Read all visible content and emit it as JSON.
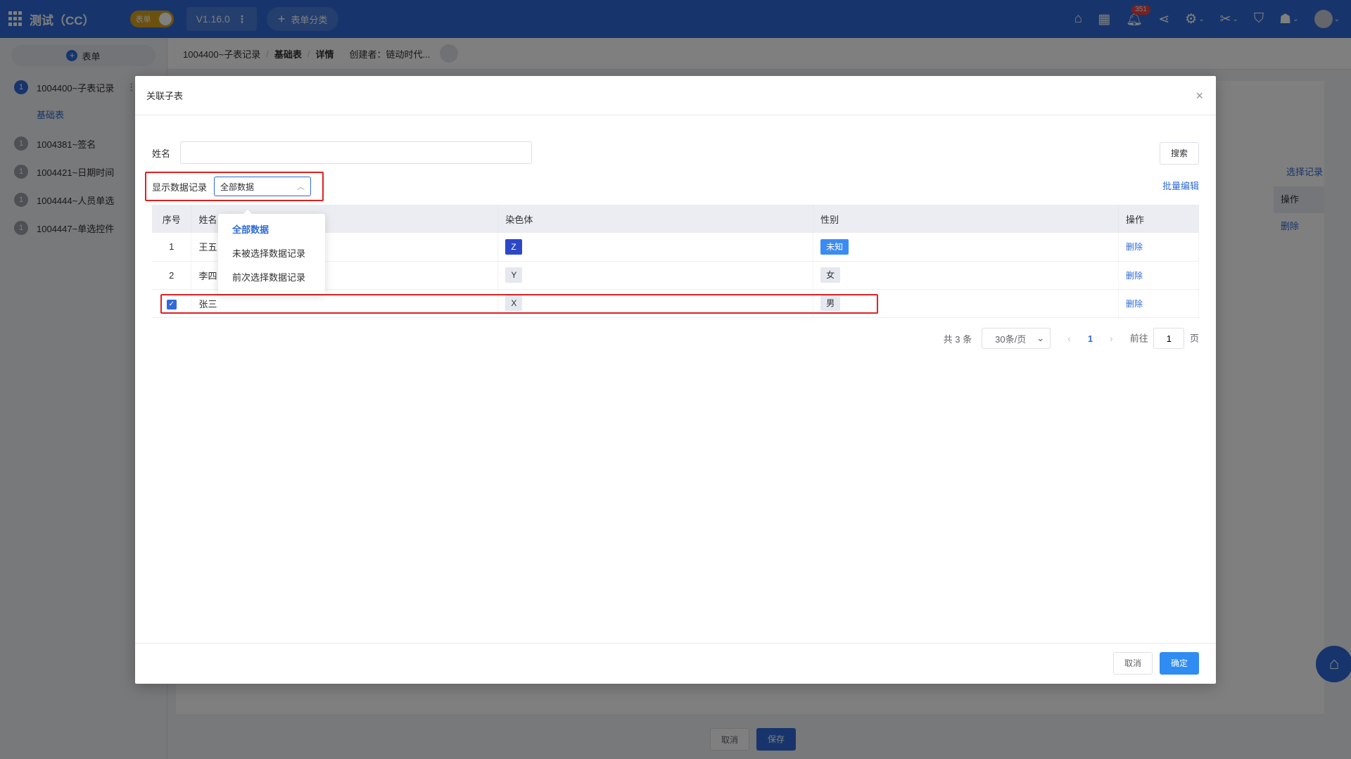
{
  "topbar": {
    "app_title": "测试（CC）",
    "toggle_label": "表单",
    "version": "V1.16.0",
    "version_more": "⋮",
    "category_plus": "+",
    "category_button": "表单分类",
    "notification_count": "351",
    "icons": [
      "home-icon",
      "grid-icon",
      "bell-icon",
      "share-icon",
      "gear-icon",
      "tools-icon",
      "shirt-icon",
      "puzzle-icon"
    ]
  },
  "sidebar": {
    "add_label": "表单",
    "add_icon": "+",
    "items": [
      {
        "num": "1",
        "label": "1004400~子表记录",
        "active": true
      },
      {
        "num": "1",
        "label": "1004381~签名"
      },
      {
        "num": "1",
        "label": "1004421~日期时间"
      },
      {
        "num": "1",
        "label": "1004444~人员单选"
      },
      {
        "num": "1",
        "label": "1004447~单选控件"
      }
    ],
    "sub_item": "基础表",
    "more": "⋮"
  },
  "page_header": {
    "crumb1": "1004400~子表记录",
    "crumb2": "基础表",
    "crumb3": "详情",
    "sep": "/",
    "creator": "创建者：链动时代..."
  },
  "background": {
    "select_records": "选择记录",
    "op_header": "操作",
    "op_delete": "删除",
    "cancel": "取消",
    "save": "保存"
  },
  "modal": {
    "title": "关联子表",
    "close": "×",
    "name_label": "姓名",
    "name_value": "",
    "search_button": "搜索",
    "show_label": "显示数据记录",
    "show_value": "全部数据",
    "batch_edit": "批量编辑",
    "dropdown": [
      "全部数据",
      "未被选择数据记录",
      "前次选择数据记录"
    ],
    "columns": [
      "序号",
      "姓名",
      "染色体",
      "性别",
      "操作"
    ],
    "rows": [
      {
        "idx": "1",
        "name": "王五",
        "chromosome": "Z",
        "gender": "未知",
        "op": "删除"
      },
      {
        "idx": "2",
        "name": "李四",
        "chromosome": "Y",
        "gender": "女",
        "op": "删除"
      },
      {
        "idx": "",
        "name": "张三",
        "chromosome": "X",
        "gender": "男",
        "op": "删除",
        "checked": true
      }
    ],
    "pager": {
      "total": "共 3 条",
      "page_size": "30条/页",
      "prev": "‹",
      "current": "1",
      "next": "›",
      "goto_label": "前往",
      "goto_value": "1",
      "goto_suffix": "页"
    },
    "cancel": "取消",
    "confirm": "确定"
  },
  "colors": {
    "primary": "#2f6bd8",
    "highlight_border": "#e02020",
    "tag_dark_blue": "#2c48c9",
    "tag_blue": "#3b8cf2"
  }
}
